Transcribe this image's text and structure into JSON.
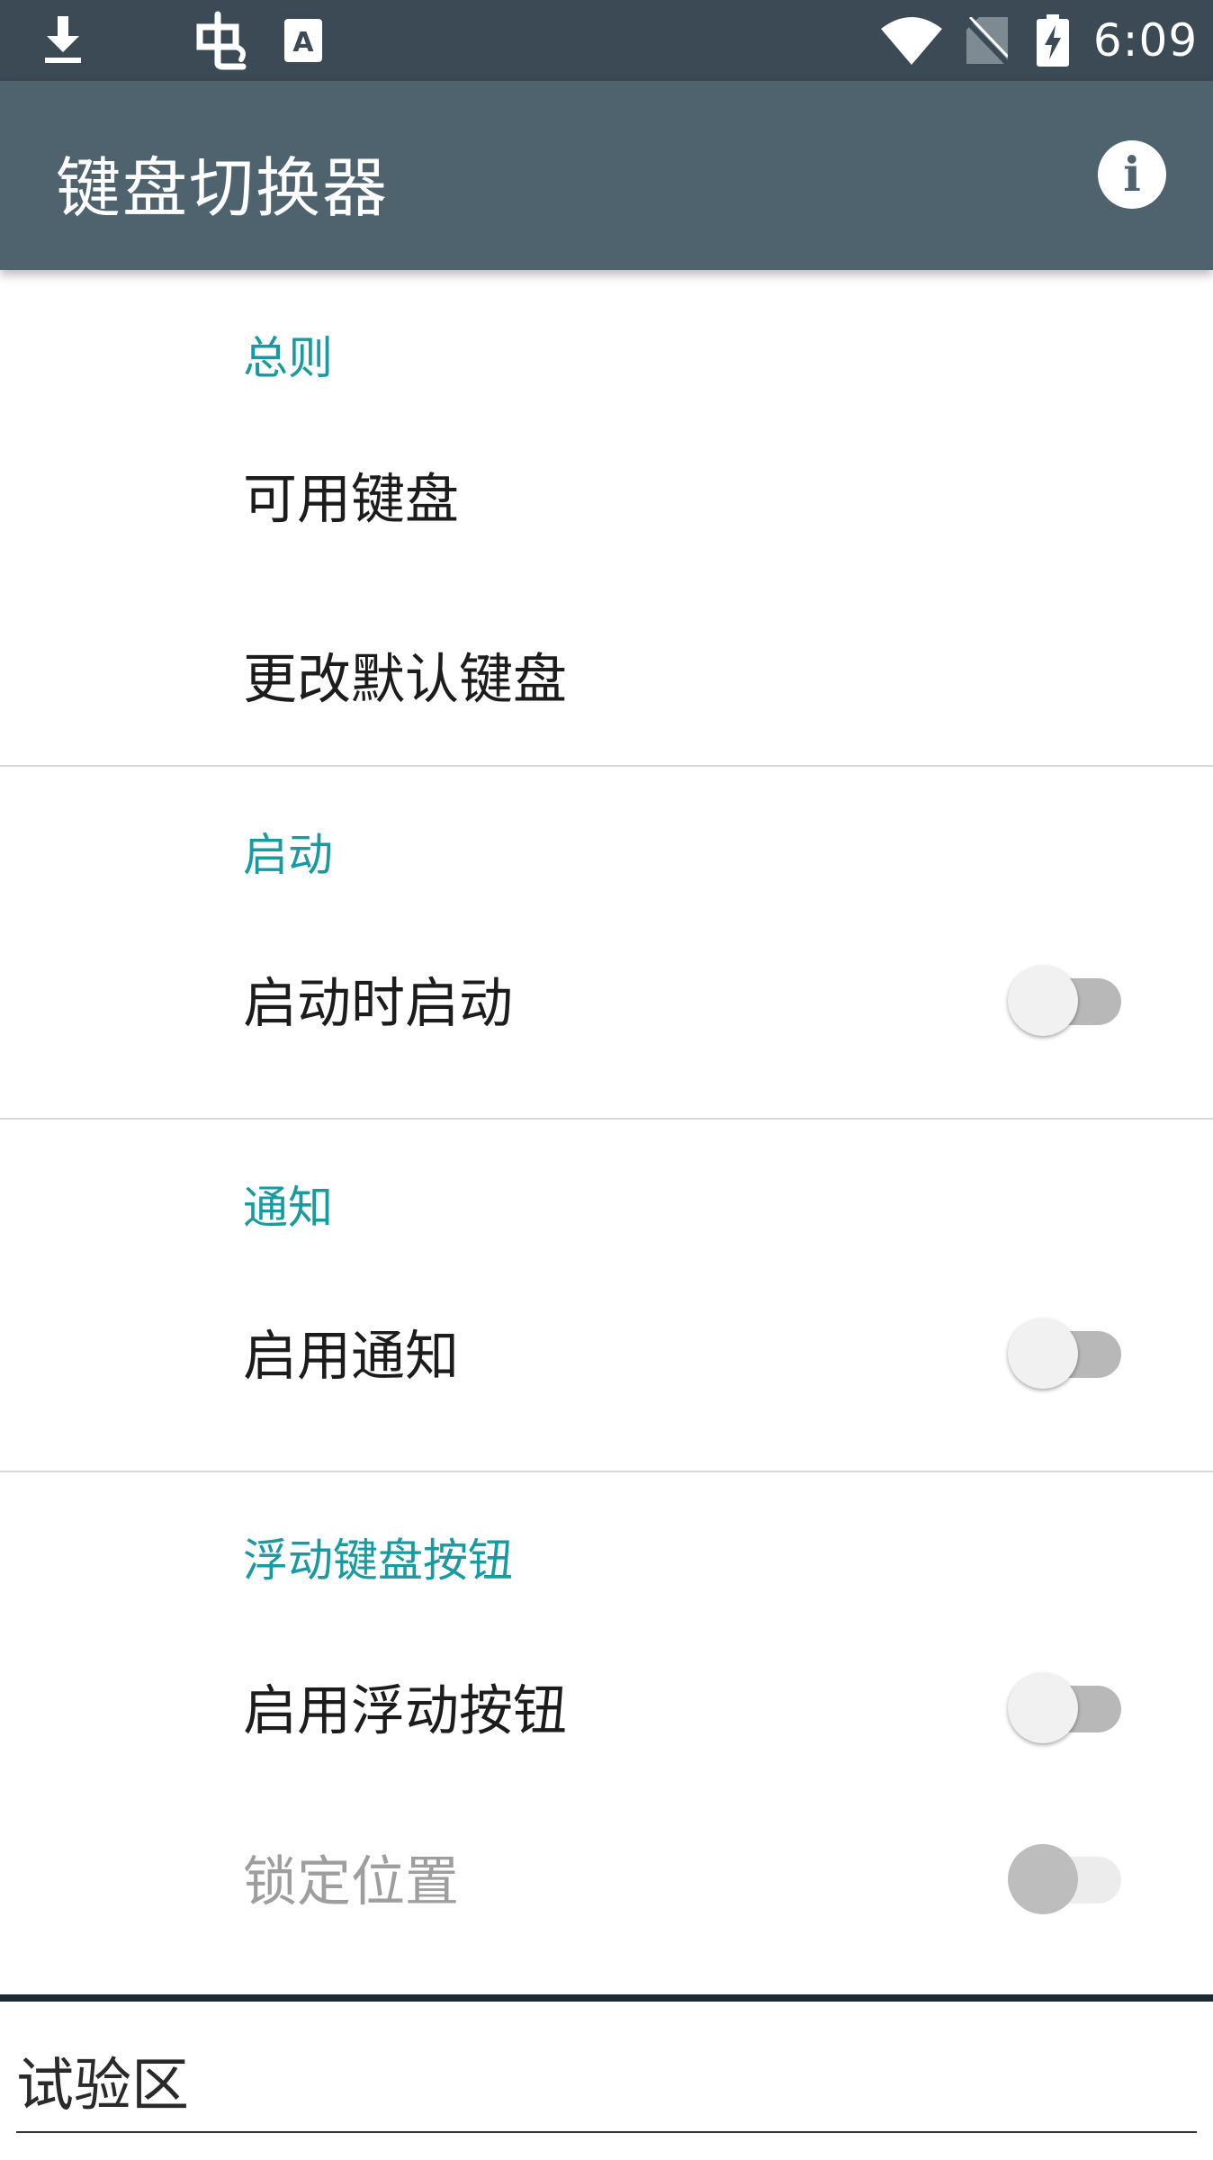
{
  "status_bar": {
    "icons": [
      "download-icon",
      "bug-app-icon",
      "keyboard-a-icon",
      "wifi-icon",
      "no-sim-icon",
      "battery-charging-icon"
    ],
    "time": "6:09"
  },
  "app_bar": {
    "title": "键盘切换器",
    "info_icon": "info-icon"
  },
  "sections": {
    "general": {
      "header": "总则",
      "items": {
        "available_keyboards": "可用键盘",
        "change_default_keyboard": "更改默认键盘"
      }
    },
    "startup": {
      "header": "启动",
      "items": {
        "start_on_boot": {
          "label": "启动时启动",
          "enabled": false
        }
      }
    },
    "notification": {
      "header": "通知",
      "items": {
        "enable_notification": {
          "label": "启用通知",
          "enabled": false
        }
      }
    },
    "floating": {
      "header": "浮动键盘按钮",
      "items": {
        "enable_floating_button": {
          "label": "启用浮动按钮",
          "enabled": false
        },
        "lock_position": {
          "label": "锁定位置",
          "enabled": false,
          "disabled": true
        }
      }
    }
  },
  "test_area": {
    "placeholder": "试验区"
  },
  "colors": {
    "status_bar": "#3b4a54",
    "app_bar": "#4f636f",
    "accent": "#179aa0"
  }
}
